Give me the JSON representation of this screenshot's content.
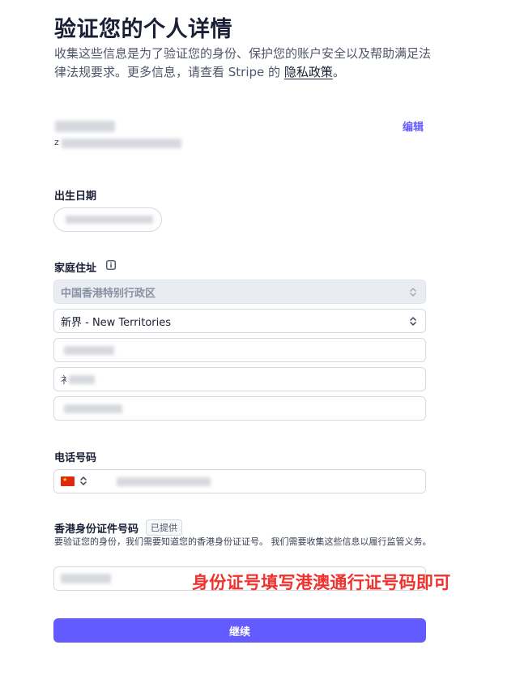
{
  "header": {
    "title": "验证您的个人详情",
    "subtitle_text": "收集这些信息是为了验证您的身份、保护您的账户安全以及帮助满足法律法规要求。更多信息，请查看 Stripe 的",
    "privacy_link": "隐私政策",
    "subtitle_end": "。"
  },
  "identity": {
    "edit_label": "编辑",
    "prefix_char": "z"
  },
  "dob": {
    "label": "出生日期"
  },
  "address": {
    "label": "家庭住址",
    "info_icon": "info-icon",
    "country_value": "中国香港特别行政区",
    "region_value": "新界 - New Territories",
    "line2_prefix": "衤"
  },
  "phone": {
    "label": "电话号码",
    "flag_icon": "china-flag-icon"
  },
  "hkid": {
    "label": "香港身份证件号码",
    "badge": "已提供",
    "description": "要验证您的身份，我们需要知道您的香港身份证证号。 我们需要收集这些信息以履行监管义务。"
  },
  "annotation": {
    "text": "身份证号填写港澳通行证号码即可",
    "color": "#f0322e"
  },
  "actions": {
    "continue_label": "继续",
    "accent_color": "#635bff"
  }
}
